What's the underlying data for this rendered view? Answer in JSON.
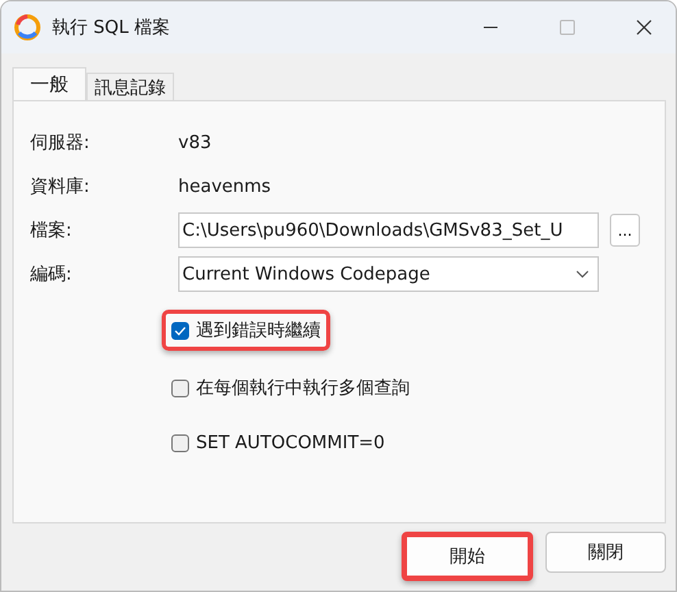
{
  "window": {
    "title": "執行 SQL 檔案"
  },
  "tabs": [
    {
      "label": "一般",
      "selected": true
    },
    {
      "label": "訊息記錄",
      "selected": false
    }
  ],
  "info": [
    {
      "label": "伺服器:",
      "value": "v83"
    },
    {
      "label": "資料庫:",
      "value": "heavenms"
    }
  ],
  "file": {
    "label": "檔案:",
    "value": "C:\\Users\\pu960\\Downloads\\GMSv83_Set_U",
    "browse": "..."
  },
  "encoding": {
    "label": "編碼:",
    "value": "Current Windows Codepage"
  },
  "options": [
    {
      "label": "遇到錯誤時繼續",
      "checked": true,
      "highlighted": true
    },
    {
      "label": "在每個執行中執行多個查詢",
      "checked": false,
      "highlighted": false
    },
    {
      "label": "SET AUTOCOMMIT=0",
      "checked": false,
      "highlighted": false
    }
  ],
  "buttons": [
    {
      "label": "開始",
      "highlighted": true
    },
    {
      "label": "關閉",
      "highlighted": false
    }
  ]
}
